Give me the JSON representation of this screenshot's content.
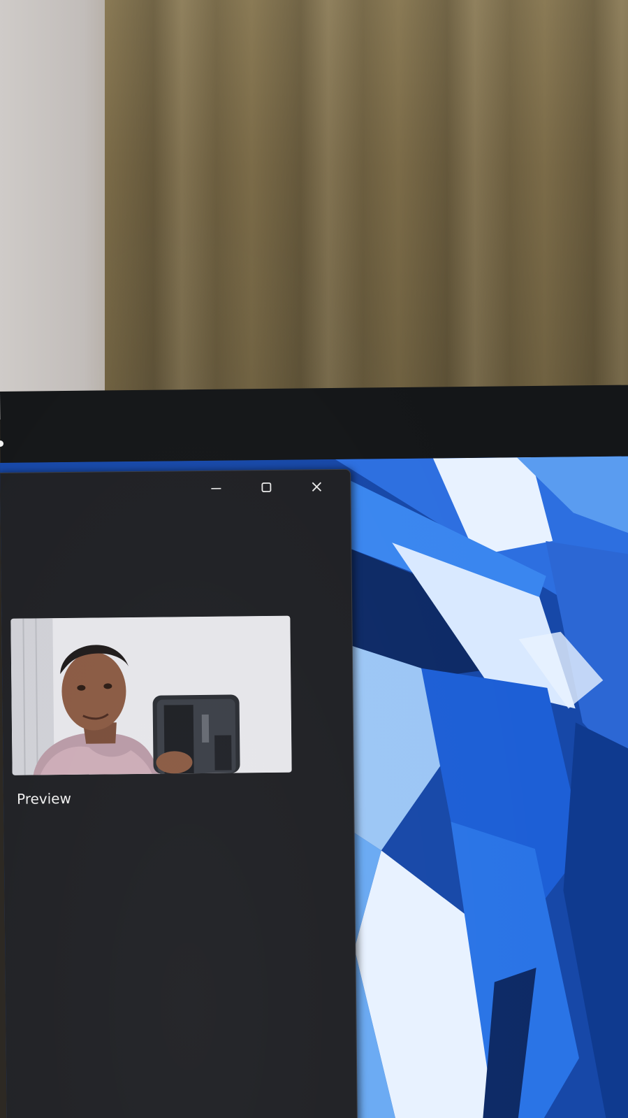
{
  "camera_app": {
    "preview_label": "Preview",
    "caption_buttons": {
      "minimize_icon": "minimize-icon",
      "maximize_icon": "maximize-icon",
      "close_icon": "close-icon"
    },
    "colors": {
      "window_background": "#1f2024",
      "label_text": "#f0f0f0"
    }
  },
  "wallpaper": {
    "colors": {
      "primary_blue": "#1d5fd6",
      "light_blue": "#9cc6f5",
      "dark_blue": "#0d2a66",
      "highlight": "#e8f2ff"
    }
  }
}
